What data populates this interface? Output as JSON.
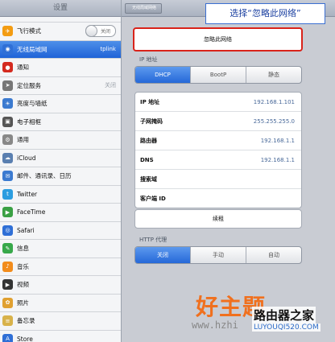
{
  "sidebar": {
    "title": "设置",
    "items": [
      {
        "label": "飞行模式",
        "icon": "airplane-icon",
        "color": "#f39c12",
        "toggle": "关闭"
      },
      {
        "label": "无线局域网",
        "icon": "wifi-icon",
        "color": "#2f6fd6",
        "value": "tplink",
        "selected": true
      },
      {
        "label": "通知",
        "icon": "notification-icon",
        "color": "#d42a1f"
      },
      {
        "label": "定位服务",
        "icon": "location-icon",
        "color": "#777777",
        "value": "关闭"
      },
      {
        "label": "亮度与墙纸",
        "icon": "brightness-icon",
        "color": "#3b7ad0"
      },
      {
        "label": "电子相框",
        "icon": "picture-frame-icon",
        "color": "#555555"
      },
      {
        "label": "通用",
        "icon": "gear-icon",
        "color": "#888888"
      },
      {
        "label": "iCloud",
        "icon": "cloud-icon",
        "color": "#5a7fb0"
      },
      {
        "label": "邮件、通讯录、日历",
        "icon": "mail-icon",
        "color": "#3b7ad0"
      },
      {
        "label": "Twitter",
        "icon": "twitter-icon",
        "color": "#2b9de0"
      },
      {
        "label": "FaceTime",
        "icon": "facetime-icon",
        "color": "#3aa044"
      },
      {
        "label": "Safari",
        "icon": "safari-icon",
        "color": "#2f6fd6"
      },
      {
        "label": "信息",
        "icon": "messages-icon",
        "color": "#37a84a"
      },
      {
        "label": "音乐",
        "icon": "music-icon",
        "color": "#f28c1c"
      },
      {
        "label": "视频",
        "icon": "video-icon",
        "color": "#333333"
      },
      {
        "label": "照片",
        "icon": "photos-icon",
        "color": "#e0a030"
      },
      {
        "label": "备忘录",
        "icon": "notes-icon",
        "color": "#d8b24a"
      },
      {
        "label": "Store",
        "icon": "store-icon",
        "color": "#2f6fd6"
      }
    ]
  },
  "nav": {
    "back_label": "无线局域网络"
  },
  "callout": "选择“忽略此网络”",
  "forget_label": "忽略此网络",
  "ip_section": {
    "label": "IP 地址",
    "segments": [
      {
        "label": "DHCP",
        "on": true
      },
      {
        "label": "BootP",
        "on": false
      },
      {
        "label": "静态",
        "on": false
      }
    ],
    "rows": [
      {
        "k": "IP 地址",
        "v": "192.168.1.101"
      },
      {
        "k": "子网掩码",
        "v": "255.255.255.0"
      },
      {
        "k": "路由器",
        "v": "192.168.1.1"
      },
      {
        "k": "DNS",
        "v": "192.168.1.1"
      },
      {
        "k": "搜索域",
        "v": ""
      },
      {
        "k": "客户端 ID",
        "v": ""
      }
    ]
  },
  "renew_label": "续租",
  "proxy_section": {
    "label": "HTTP 代理",
    "segments": [
      {
        "label": "关闭",
        "on": true
      },
      {
        "label": "手动",
        "on": false
      },
      {
        "label": "自动",
        "on": false
      }
    ]
  },
  "watermark": {
    "big": "好主题",
    "url": "www.hzhi",
    "brand": "路由器之家",
    "brand_url": "LUYOUQI520.COM"
  }
}
